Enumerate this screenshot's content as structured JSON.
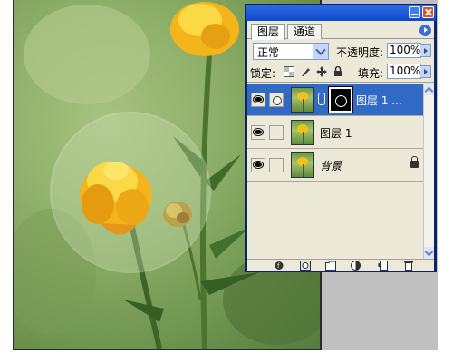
{
  "panel": {
    "tabs": [
      {
        "label": "图层",
        "active": true
      },
      {
        "label": "通道",
        "active": false
      }
    ],
    "blend_mode": "正常",
    "opacity_label": "不透明度:",
    "opacity_value": "100%",
    "lock_label": "锁定:",
    "fill_label": "填充:",
    "fill_value": "100%",
    "layers": [
      {
        "name": "图层 1 ...",
        "visible": true,
        "selected": true,
        "has_mask": true,
        "italic": false,
        "locked": false
      },
      {
        "name": "图层 1",
        "visible": true,
        "selected": false,
        "has_mask": false,
        "italic": false,
        "locked": false
      },
      {
        "name": "背景",
        "visible": true,
        "selected": false,
        "has_mask": false,
        "italic": true,
        "locked": true
      }
    ],
    "lock_icons": [
      "lock-transparent-icon",
      "lock-paint-icon",
      "lock-move-icon",
      "lock-all-icon"
    ],
    "bottom_icons": [
      "link-layers-icon",
      "layer-style-icon",
      "add-mask-icon",
      "new-group-icon",
      "adjustment-layer-icon",
      "new-layer-icon",
      "delete-layer-icon"
    ]
  },
  "colors": {
    "titlebar": "#0f49c9",
    "selected_row": "#316ac5",
    "panel_bg": "#ece9d8",
    "close_button": "#d9512c"
  }
}
